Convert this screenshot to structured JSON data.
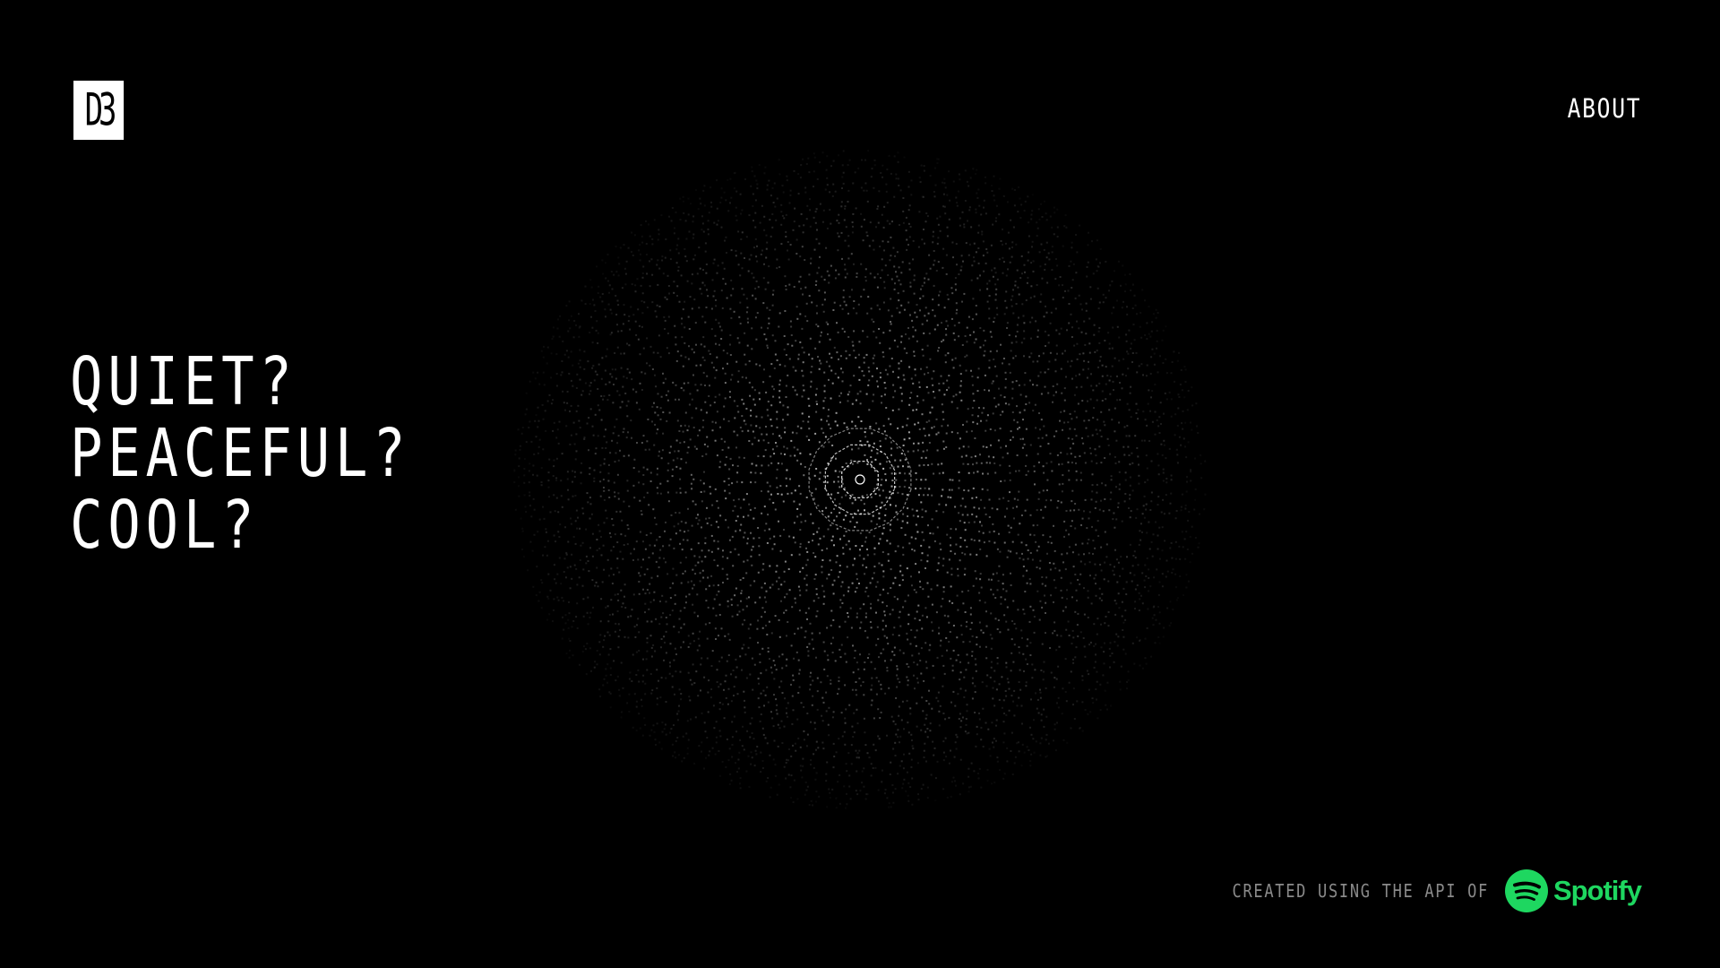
{
  "header": {
    "logo_text": "D3",
    "about_label": "ABOUT"
  },
  "hero": {
    "lines": [
      "QUIET?",
      "PEACEFUL?",
      "COOL?"
    ]
  },
  "footer": {
    "credit_text": "CREATED USING THE API OF",
    "spotify_word": "Spotify",
    "spotify_icon": "spotify-icon"
  },
  "visualizer": {
    "icon": "radial-dot-visualizer"
  },
  "colors": {
    "background": "#000000",
    "text": "#ffffff",
    "muted": "#8a8a8a",
    "spotify_green": "#1ed760",
    "dots": "#ffffff"
  }
}
